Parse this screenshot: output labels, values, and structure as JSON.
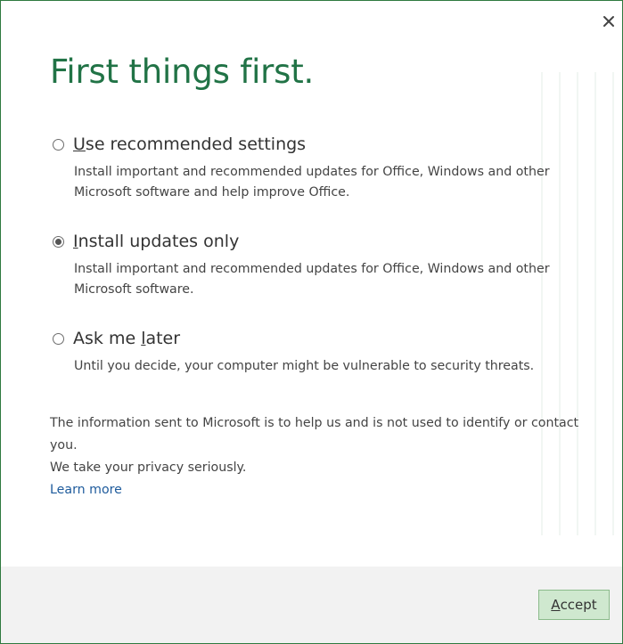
{
  "dialog": {
    "title": "First things first.",
    "close_icon": "close-icon"
  },
  "options": [
    {
      "label_prefix": "",
      "label_accel": "U",
      "label_rest": "se recommended settings",
      "description": "Install important and recommended updates for Office, Windows and other Microsoft software and help improve Office.",
      "selected": false
    },
    {
      "label_prefix": "",
      "label_accel": "I",
      "label_rest": "nstall updates only",
      "description": "Install important and recommended updates for Office, Windows and other Microsoft software.",
      "selected": true
    },
    {
      "label_prefix": "Ask me ",
      "label_accel": "l",
      "label_rest": "ater",
      "description": "Until you decide, your computer might be vulnerable to security threats.",
      "selected": false
    }
  ],
  "info": {
    "line1": "The information sent to Microsoft is to help us and is not used to identify or contact you.",
    "line2": "We take your privacy seriously.",
    "learn_more": "Learn more"
  },
  "footer": {
    "accept_accel": "A",
    "accept_rest": "ccept"
  },
  "colors": {
    "accent": "#217346",
    "link": "#1e5b9c",
    "footer_bg": "#f2f2f2",
    "accept_bg": "#cfe8cf"
  }
}
